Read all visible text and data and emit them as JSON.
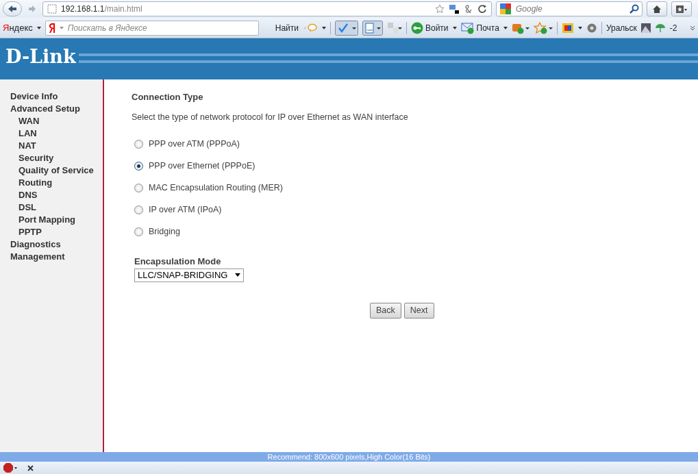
{
  "browser": {
    "address": {
      "host": "192.168.1.1",
      "path": "/main.html"
    },
    "search_placeholder": "Google"
  },
  "yandex_bar": {
    "brand": "Яндекс",
    "search_placeholder": "Поискать в Яндексе",
    "find_button": "Найти",
    "login": "Войти",
    "mail": "Почта",
    "city": "Уральск",
    "temperature": "-2"
  },
  "header": {
    "logo": "D-Link"
  },
  "sidebar": {
    "items": [
      {
        "label": "Device Info"
      },
      {
        "label": "Advanced Setup",
        "children": [
          {
            "label": "WAN"
          },
          {
            "label": "LAN"
          },
          {
            "label": "NAT"
          },
          {
            "label": "Security"
          },
          {
            "label": "Quality of Service"
          },
          {
            "label": "Routing"
          },
          {
            "label": "DNS"
          },
          {
            "label": "DSL"
          },
          {
            "label": "Port Mapping"
          },
          {
            "label": "PPTP"
          }
        ]
      },
      {
        "label": "Diagnostics"
      },
      {
        "label": "Management"
      }
    ]
  },
  "content": {
    "title": "Connection Type",
    "description": "Select the type of network protocol for IP over Ethernet as WAN interface",
    "options": [
      {
        "label": "PPP over ATM (PPPoA)",
        "selected": false
      },
      {
        "label": "PPP over Ethernet (PPPoE)",
        "selected": true
      },
      {
        "label": "MAC Encapsulation Routing (MER)",
        "selected": false
      },
      {
        "label": "IP over ATM (IPoA)",
        "selected": false
      },
      {
        "label": "Bridging",
        "selected": false
      }
    ],
    "encapsulation": {
      "label": "Encapsulation Mode",
      "value": "LLC/SNAP-BRIDGING"
    },
    "buttons": [
      "Back",
      "Next"
    ]
  },
  "status_bar": "Recommend: 800x600 pixels,High Color(16 Bits)"
}
